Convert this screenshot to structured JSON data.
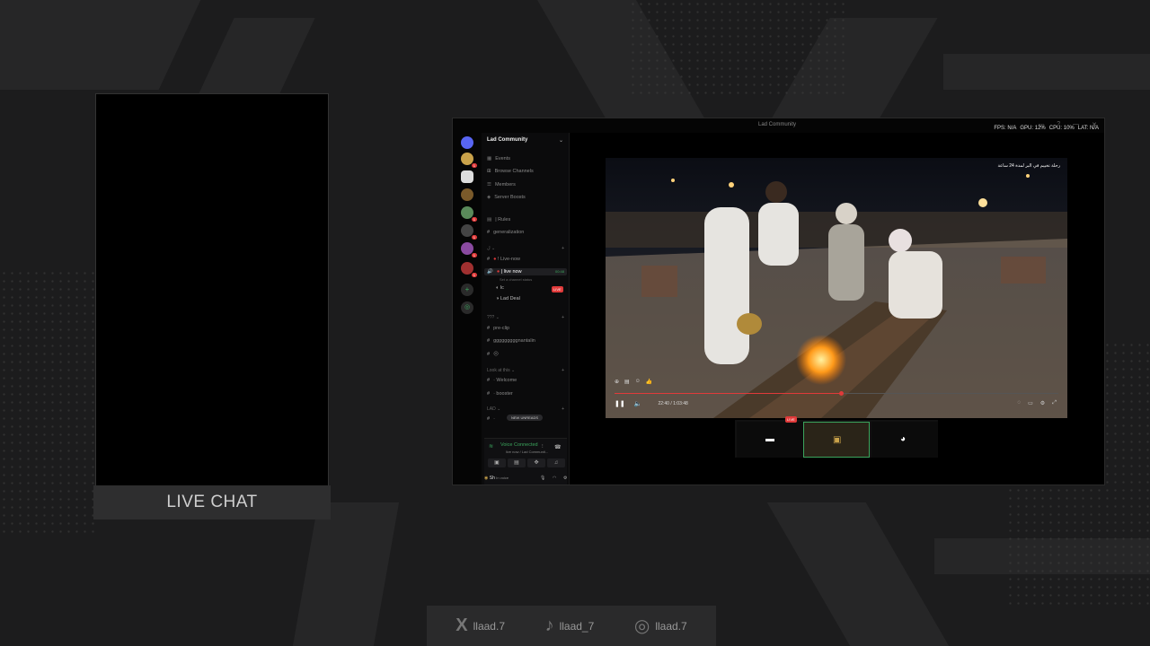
{
  "chat": {
    "label": "LIVE CHAT"
  },
  "discord": {
    "window_title": "Lad Community",
    "stats": [
      "FPS: N/A",
      "GPU: 12%",
      "CPU: 10%",
      "LAT: N/A"
    ],
    "server_name": "Lad Community",
    "top_items": [
      "Events",
      "Browse Channels",
      "Members",
      "Server Boosts"
    ],
    "channels": {
      "rules": "| Rules",
      "general": "generalization",
      "cat1": "ل",
      "live_now_1": "! Live-now",
      "live_now_2": "| live now",
      "live_now_status": "Set a channel status",
      "live_now_time": "00:48",
      "voice_user_1": "lc",
      "voice_user_2": "Lad  Deal",
      "cat2": "???",
      "pre_clip": "pre-clip",
      "channel_long": "gggggggggnantalin",
      "emoji_channel": "😐",
      "cat3": "Look at this",
      "welcome": "· Welcome",
      "booster": "· booster",
      "cat4": "LAD",
      "new_unreads": "NEW UNREADS"
    },
    "voice": {
      "title": "Voice Connected",
      "sub": "live now / Lad Communit..."
    },
    "user": {
      "name": "Sh",
      "status": "In voice"
    },
    "live_badge": "LIVE",
    "video": {
      "overlay": "رحلة تخييم في البر لمدة 24 ساعة",
      "time": "22:40 / 1:03:48",
      "progress": 0.51
    }
  },
  "socials": [
    {
      "icon": "x-icon",
      "glyph": "X",
      "handle": "llaad.7"
    },
    {
      "icon": "tiktok-icon",
      "glyph": "♪",
      "handle": "llaad_7"
    },
    {
      "icon": "instagram-icon",
      "glyph": "◎",
      "handle": "llaad.7"
    }
  ]
}
